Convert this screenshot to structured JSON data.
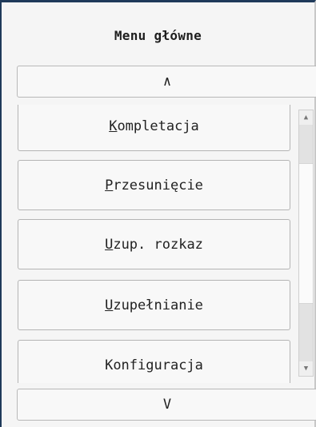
{
  "header": {
    "title": "Menu główne"
  },
  "nav": {
    "up_label": "∧",
    "down_label": "V"
  },
  "menu": {
    "items": [
      {
        "label": "Kompletacja",
        "mnemonic": "K",
        "rest": "ompletacja"
      },
      {
        "label": "Przesunięcie",
        "mnemonic": "P",
        "rest": "rzesunięcie"
      },
      {
        "label": "Uzup. rozkaz",
        "mnemonic": "U",
        "rest": "zup. rozkaz"
      },
      {
        "label": "Uzupełnianie",
        "mnemonic": "U",
        "rest": "zupełnianie"
      },
      {
        "label": "Konfiguracja",
        "mnemonic": "",
        "rest": "Konfiguracja"
      }
    ]
  },
  "scrollbar": {
    "up_icon": "triangle-up-icon",
    "down_icon": "triangle-down-icon"
  }
}
